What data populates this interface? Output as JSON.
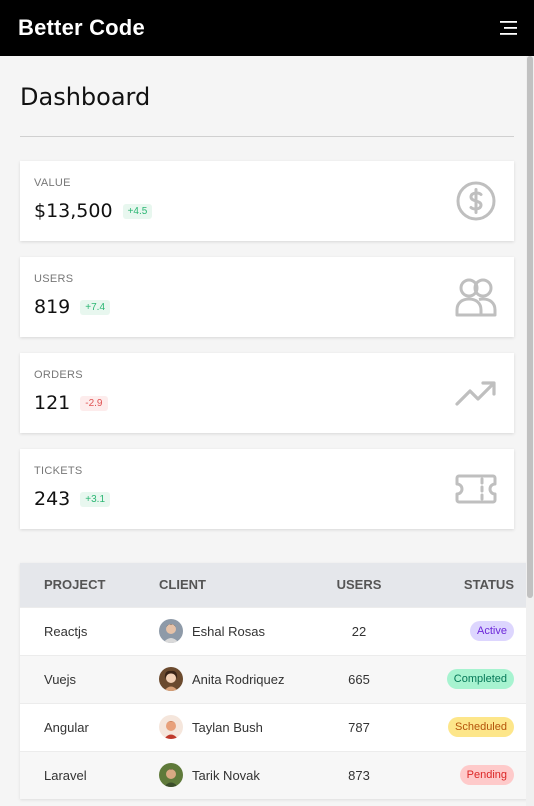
{
  "header": {
    "brand": "Better Code",
    "menu_icon": "hamburger-icon"
  },
  "page": {
    "title": "Dashboard"
  },
  "stats": [
    {
      "label": "VALUE",
      "value": "$13,500",
      "change": "+4.5",
      "trend": "up",
      "icon": "dollar-circle-icon"
    },
    {
      "label": "USERS",
      "value": "819",
      "change": "+7.4",
      "trend": "up",
      "icon": "users-icon"
    },
    {
      "label": "ORDERS",
      "value": "121",
      "change": "-2.9",
      "trend": "down",
      "icon": "trending-up-icon"
    },
    {
      "label": "TICKETS",
      "value": "243",
      "change": "+3.1",
      "trend": "up",
      "icon": "ticket-icon"
    }
  ],
  "table": {
    "headers": {
      "project": "PROJECT",
      "client": "CLIENT",
      "users": "USERS",
      "status": "STATUS"
    },
    "rows": [
      {
        "project": "Reactjs",
        "client": "Eshal Rosas",
        "users": "22",
        "status": "Active",
        "status_bg": "#ddd6fe",
        "status_fg": "#6d28d9",
        "avatar_bg": "#8e9aa8"
      },
      {
        "project": "Vuejs",
        "client": "Anita Rodriquez",
        "users": "665",
        "status": "Completed",
        "status_bg": "#a7f3d0",
        "status_fg": "#047857",
        "avatar_bg": "#6b4a2e"
      },
      {
        "project": "Angular",
        "client": "Taylan Bush",
        "users": "787",
        "status": "Scheduled",
        "status_bg": "#fde68a",
        "status_fg": "#b45309",
        "avatar_bg": "#e8a07a"
      },
      {
        "project": "Laravel",
        "client": "Tarik Novak",
        "users": "873",
        "status": "Pending",
        "status_bg": "#fecaca",
        "status_fg": "#dc2626",
        "avatar_bg": "#5f7a3a"
      }
    ]
  }
}
